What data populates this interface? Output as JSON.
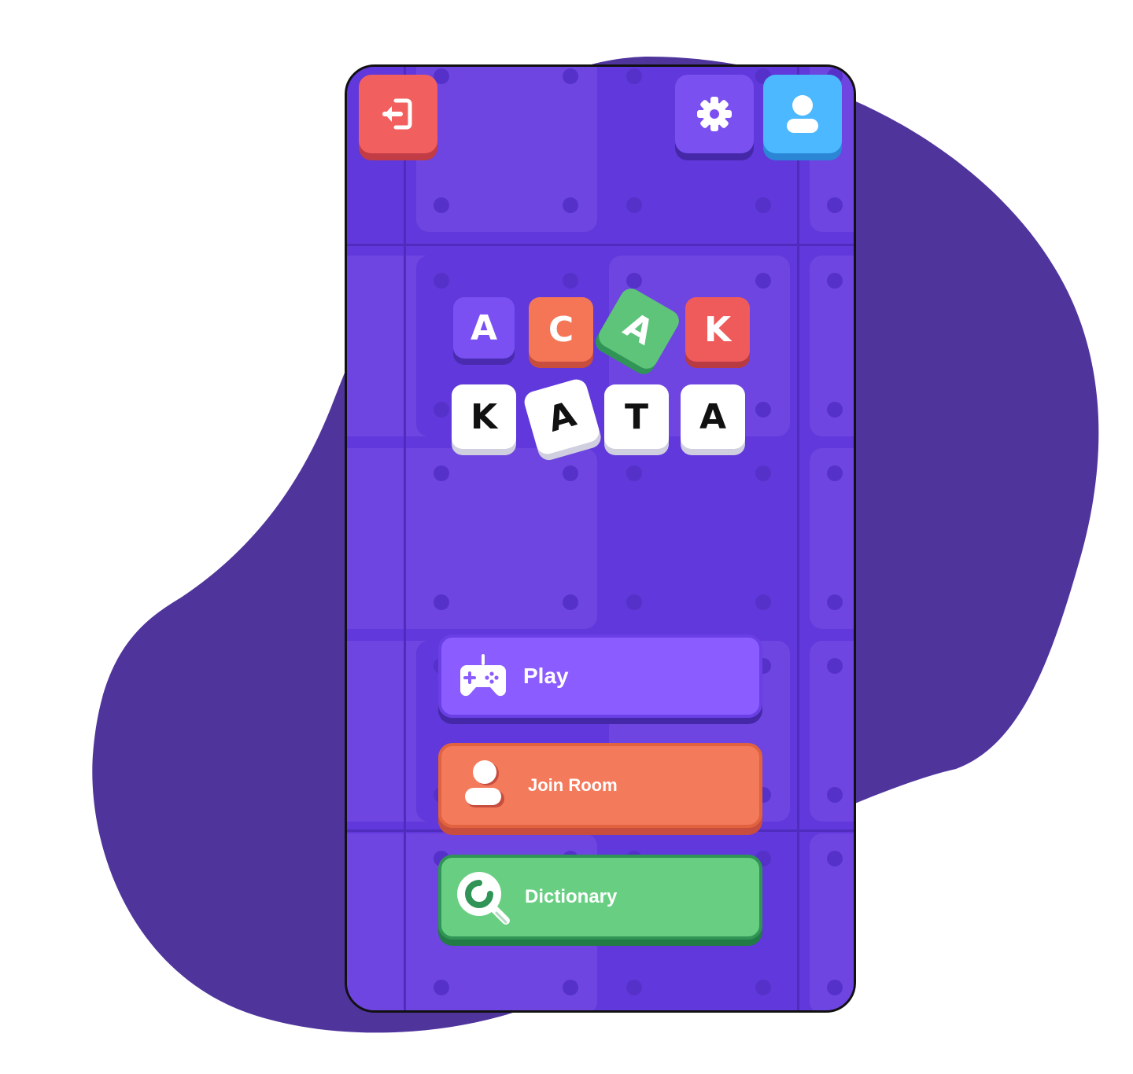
{
  "colors": {
    "background_blob": "#4f349c",
    "screen_bg": "#6038db",
    "cell_light": "#7049e0",
    "exit": "#f25f5f",
    "settings": "#7b50f0",
    "profile": "#4cb8ff",
    "play": "#8b5cff",
    "join": "#f47a5c",
    "dictionary": "#68cf82"
  },
  "header": {
    "exit_icon": "exit-door-icon",
    "settings_icon": "gear-icon",
    "profile_icon": "user-icon"
  },
  "logo": {
    "row1": [
      "A",
      "C",
      "A",
      "K"
    ],
    "row2": [
      "K",
      "A",
      "T",
      "A"
    ]
  },
  "menu": {
    "play": {
      "label": "Play",
      "icon": "gamepad-icon"
    },
    "join_room": {
      "label": "Join Room",
      "icon": "user-icon"
    },
    "dictionary": {
      "label": "Dictionary",
      "icon": "magnifier-icon"
    }
  }
}
